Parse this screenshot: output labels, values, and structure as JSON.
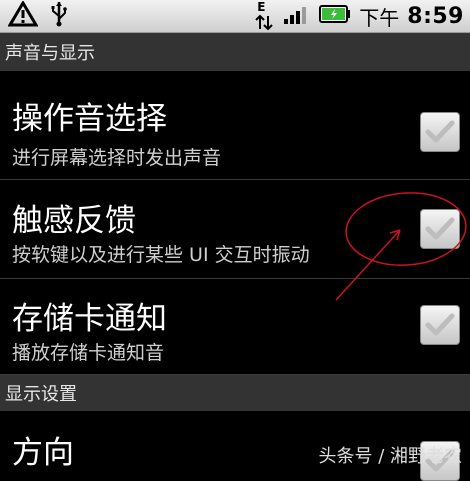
{
  "status_bar": {
    "network_letter": "E",
    "ampm": "下午",
    "time": "8:59",
    "icons": [
      "warning-icon",
      "usb-icon",
      "network-data-icon",
      "signal-icon",
      "battery-icon"
    ]
  },
  "sections": [
    {
      "header": "声音与显示",
      "items": [
        {
          "title": "操作音选择",
          "summary": "进行屏幕选择时发出声音",
          "checked": false
        },
        {
          "title": "触感反馈",
          "summary": "按软键以及进行某些 UI 交互时振动",
          "checked": false
        },
        {
          "title": "存储卡通知",
          "summary": "播放存储卡通知音",
          "checked": false
        }
      ]
    },
    {
      "header": "显示设置",
      "items": [
        {
          "title": "方向",
          "summary": "",
          "checked": false
        }
      ]
    }
  ],
  "watermark": "头条号 / 湘野老农",
  "colors": {
    "annotation": "#c8141e",
    "checkmark": "#bdbdbd",
    "battery": "#3cbb3c"
  }
}
